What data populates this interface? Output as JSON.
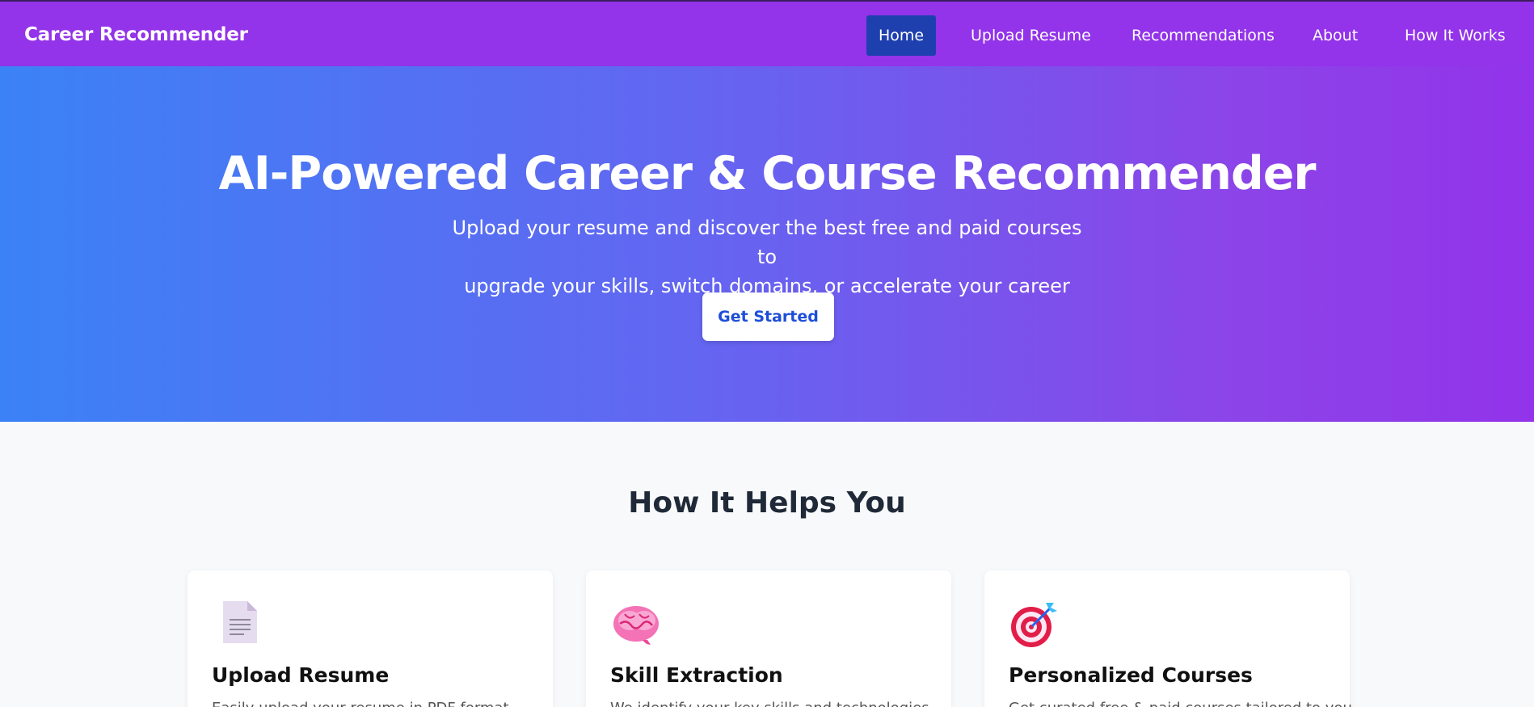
{
  "nav": {
    "brand": "Career Recommender",
    "items": [
      {
        "label": "Home",
        "active": true
      },
      {
        "label": "Upload Resume"
      },
      {
        "label": "Recommendations"
      },
      {
        "label": "About"
      },
      {
        "label": "How It Works"
      }
    ]
  },
  "hero": {
    "title": "AI-Powered Career & Course Recommender",
    "subtitle_line1": "Upload your resume and discover the best free and paid courses to",
    "subtitle_line2": "upgrade your skills, switch domains, or accelerate your career growth.",
    "cta_label": "Get Started"
  },
  "features": {
    "title": "How It Helps You",
    "cards": [
      {
        "icon": "document-icon",
        "title": "Upload Resume",
        "desc": "Easily upload your resume in PDF format."
      },
      {
        "icon": "brain-icon",
        "title": "Skill Extraction",
        "desc": "We identify your key skills and technologies."
      },
      {
        "icon": "target-icon",
        "title": "Personalized Courses",
        "desc": "Get curated free & paid courses tailored to you."
      }
    ]
  },
  "colors": {
    "navbar": "#9333ea",
    "active_nav": "#1e40af",
    "hero_start": "#3b82f6",
    "hero_end": "#9333ea",
    "cta_text": "#1d4ed8"
  }
}
